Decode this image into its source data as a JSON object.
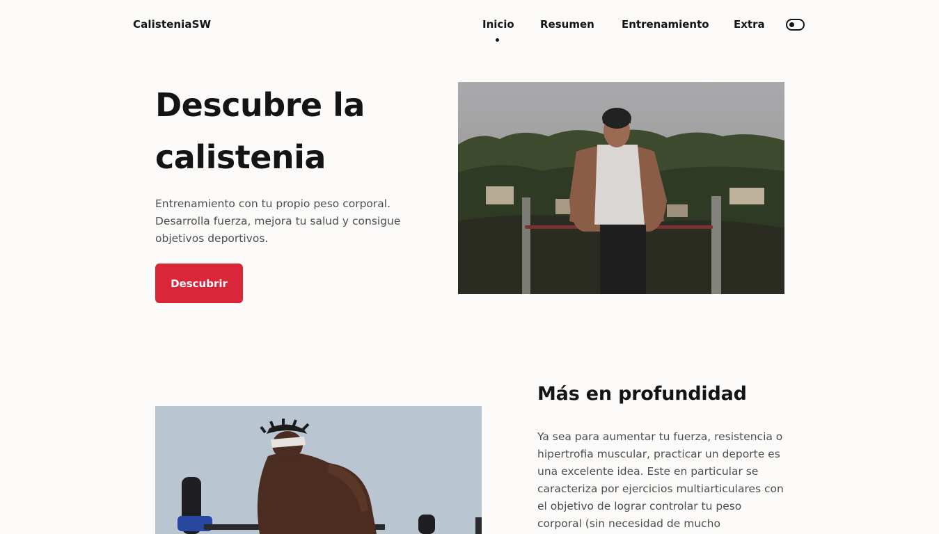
{
  "header": {
    "logo": "CalisteniaSW",
    "nav": [
      "Inicio",
      "Resumen",
      "Entrenamiento",
      "Extra"
    ],
    "active_nav": "Inicio",
    "toggle_icon": "dark-mode-toggle-icon"
  },
  "hero": {
    "title": "Descubre la calistenia",
    "description": "Entrenamiento con tu propio peso corporal. Desarrolla fuerza, mejora tu salud y consigue objetivos deportivos.",
    "button_label": "Descubrir",
    "image_alt": "man-doing-dips-on-parallel-bars"
  },
  "section": {
    "title": "Más en profundidad",
    "text": "Ya sea para aumentar tu fuerza, resistencia o hipertrofia muscular, practicar un deporte es una excelente idea. Este en particular se caracteriza por ejercicios multiarticulares con el objetivo de lograr controlar tu peso corporal (sin necesidad de mucho",
    "image_alt": "athlete-on-parallel-bars"
  },
  "colors": {
    "background": "#fcfbfa",
    "text": "#141414",
    "muted": "#4d4d4d",
    "accent": "#d92638"
  }
}
